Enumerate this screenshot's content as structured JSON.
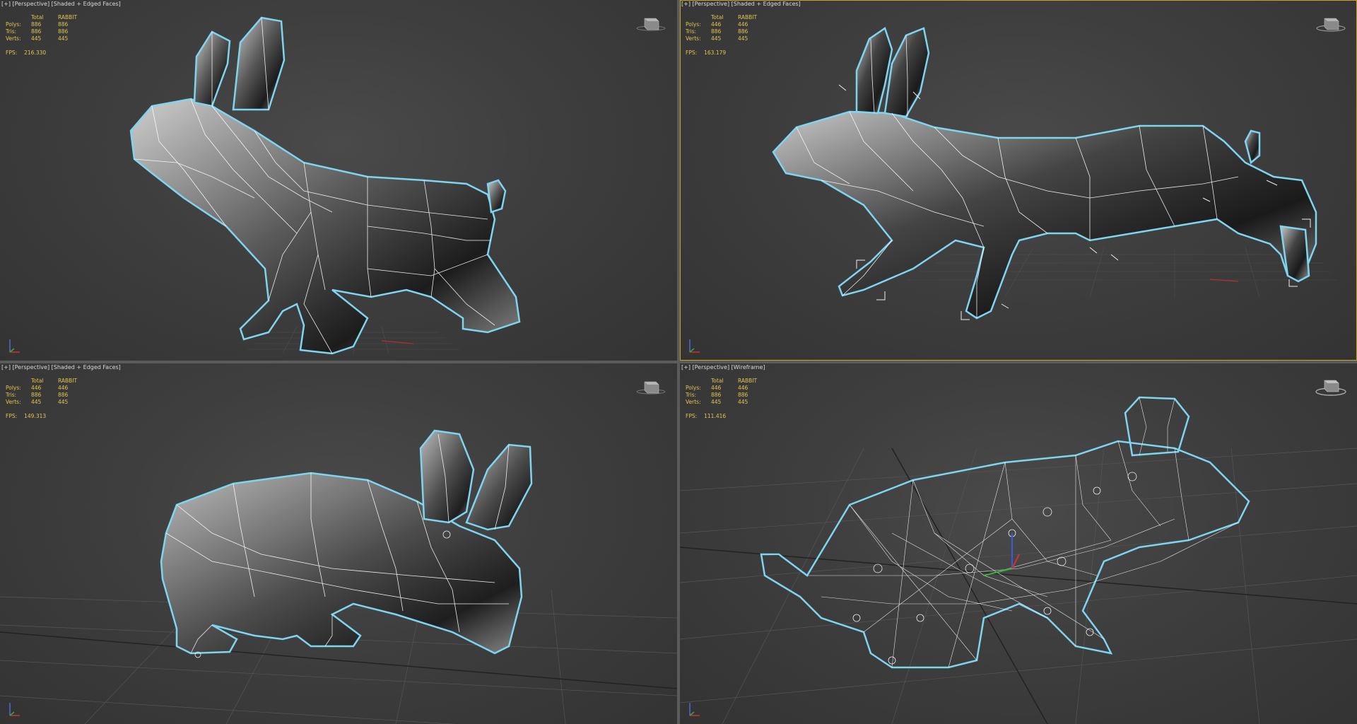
{
  "viewports": [
    {
      "label_plus": "[+]",
      "label_view": "[Perspective]",
      "label_shading": "[Shaded + Edged Faces]",
      "stats": {
        "col_total": "Total",
        "col_object": "RABBIT",
        "rows": [
          {
            "label": "Polys:",
            "total": "886",
            "object": "886"
          },
          {
            "label": "Tris:",
            "total": "886",
            "object": "886"
          },
          {
            "label": "Verts:",
            "total": "445",
            "object": "445"
          }
        ]
      },
      "fps_label": "FPS:",
      "fps_value": "216.330"
    },
    {
      "label_plus": "[+]",
      "label_view": "[Perspective]",
      "label_shading": "[Shaded + Edged Faces]",
      "stats": {
        "col_total": "Total",
        "col_object": "RABBIT",
        "rows": [
          {
            "label": "Polys:",
            "total": "446",
            "object": "446"
          },
          {
            "label": "Tris:",
            "total": "886",
            "object": "886"
          },
          {
            "label": "Verts:",
            "total": "445",
            "object": "445"
          }
        ]
      },
      "fps_label": "FPS:",
      "fps_value": "163.179"
    },
    {
      "label_plus": "[+]",
      "label_view": "[Perspective]",
      "label_shading": "[Shaded + Edged Faces]",
      "stats": {
        "col_total": "Total",
        "col_object": "RABBIT",
        "rows": [
          {
            "label": "Polys:",
            "total": "446",
            "object": "446"
          },
          {
            "label": "Tris:",
            "total": "886",
            "object": "886"
          },
          {
            "label": "Verts:",
            "total": "445",
            "object": "445"
          }
        ]
      },
      "fps_label": "FPS:",
      "fps_value": "149.313"
    },
    {
      "label_plus": "[+]",
      "label_view": "[Perspective]",
      "label_shading": "[Wireframe]",
      "stats": {
        "col_total": "Total",
        "col_object": "RABBIT",
        "rows": [
          {
            "label": "Polys:",
            "total": "446",
            "object": "446"
          },
          {
            "label": "Tris:",
            "total": "886",
            "object": "886"
          },
          {
            "label": "Verts:",
            "total": "445",
            "object": "445"
          }
        ]
      },
      "fps_label": "FPS:",
      "fps_value": "111.416"
    }
  ],
  "colors": {
    "stats_text": "#e3c44d",
    "selection_outline": "#7fd4f0",
    "edge": "#ffffff",
    "active_border": "#c9a227"
  },
  "icons": [
    "viewcube-icon",
    "axis-tripod-icon"
  ]
}
